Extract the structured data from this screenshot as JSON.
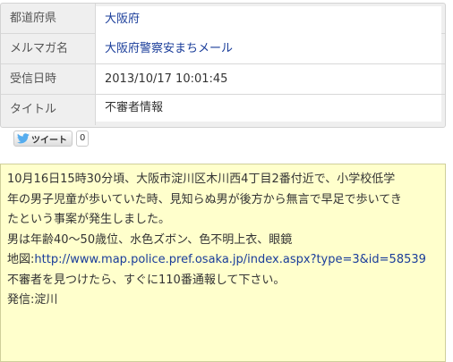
{
  "info": {
    "rows": [
      {
        "label": "都道府県",
        "value": "大阪府"
      },
      {
        "label": "メルマガ名",
        "value": "大阪府警察安まちメール"
      },
      {
        "label": "受信日時",
        "value": "2013/10/17 10:01:45"
      },
      {
        "label": "タイトル",
        "value": "不審者情報"
      }
    ]
  },
  "social": {
    "tweet_label": "ツイート",
    "tweet_count": "0",
    "icon": "twitter-bird-icon",
    "icon_color": "#55acee"
  },
  "message": {
    "lines": [
      "10月16日15時30分頃、大阪市淀川区木川西4丁目2番付近で、小学校低学",
      "年の男子児童が歩いていた時、見知らぬ男が後方から無言で早足で歩いてき",
      "たという事案が発生しました。",
      "男は年齢40～50歳位、水色ズボン、色不明上衣、眼鏡"
    ],
    "map_prefix": "地図:",
    "map_url": "http://www.map.police.pref.osaka.jp/index.aspx?type=3&id=58539",
    "after_lines": [
      "不審者を見つけたら、すぐに110番通報して下さい。",
      "発信:淀川"
    ]
  },
  "colors": {
    "link": "#1a3d9a",
    "message_bg": "#ffffcc",
    "table_bg": "#efefef"
  }
}
